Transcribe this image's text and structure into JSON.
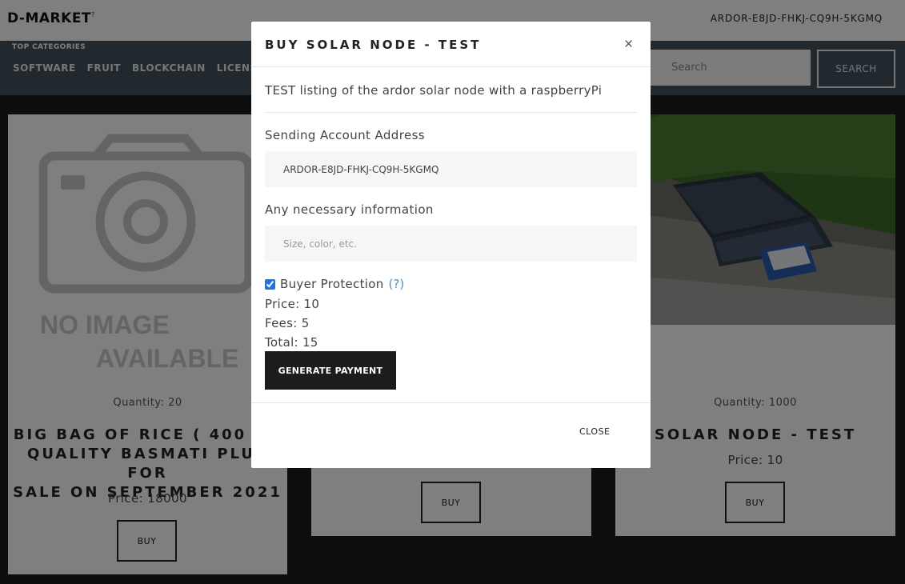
{
  "header": {
    "brand": "D-MARKET",
    "brand_sup": "?",
    "account": "ARDOR-E8JD-FHKJ-CQ9H-5KGMQ"
  },
  "nav": {
    "top_categories_label": "TOP CATEGORIES",
    "categories": [
      "SOFTWARE",
      "FRUIT",
      "BLOCKCHAIN",
      "LICENSE"
    ],
    "search_placeholder": "Search",
    "search_button": "SEARCH"
  },
  "products": [
    {
      "image_text_1": "NO IMAGE",
      "image_text_2": "AVAILABLE",
      "quantity": "Quantity: 20",
      "title": "BIG BAG OF RICE ( 400 KG QUALITY BASMATI PLUS F... SALE ON SEPTEMBER 2021",
      "title_lines": [
        "BIG BAG OF RICE ( 400 KG",
        "QUALITY BASMATI PLUS FOR",
        "SALE ON SEPTEMBER 2021"
      ],
      "price": "Price: 18000",
      "buy": "BUY"
    },
    {
      "buy": "BUY"
    },
    {
      "quantity": "Quantity: 1000",
      "title": "SOLAR NODE - TEST",
      "price": "Price: 10",
      "buy": "BUY"
    }
  ],
  "modal": {
    "title": "BUY SOLAR NODE - TEST",
    "close_x": "×",
    "description": "TEST listing of the ardor solar node with a raspberryPi",
    "sending_label": "Sending Account Address",
    "sending_value": "ARDOR-E8JD-FHKJ-CQ9H-5KGMQ",
    "info_label": "Any necessary information",
    "info_placeholder": "Size, color, etc.",
    "buyer_protection_label": "Buyer Protection",
    "buyer_protection_help": "(?)",
    "buyer_protection_checked": true,
    "price_line": "Price: 10",
    "fees_line": "Fees: 5",
    "total_line": "Total: 15",
    "generate_button": "GENERATE PAYMENT",
    "close_button": "CLOSE"
  },
  "colors": {
    "nav_bg": "#43505c",
    "page_bg": "#1a1a1a",
    "primary_button": "#1c1c1c",
    "link": "#4a90c2"
  }
}
